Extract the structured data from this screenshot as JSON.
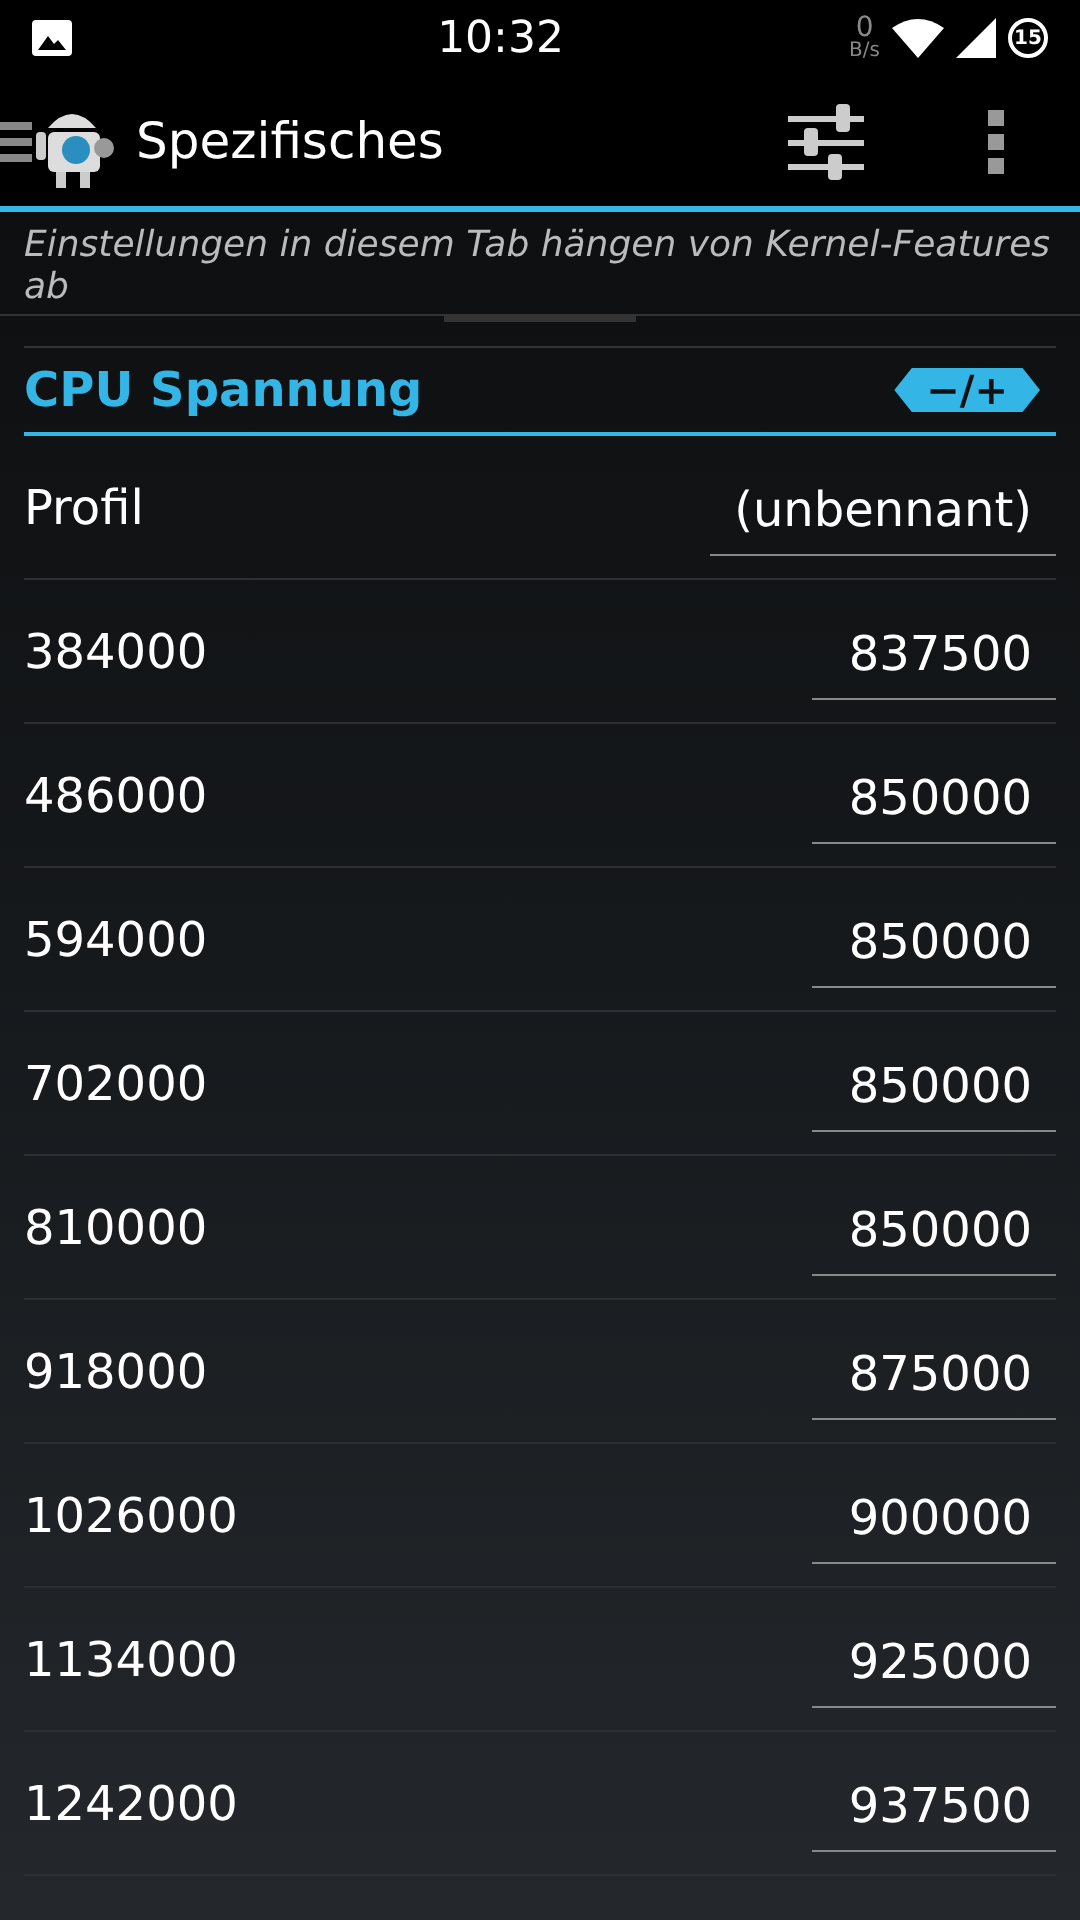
{
  "status_bar": {
    "time": "10:32",
    "net_speed_value": "0",
    "net_speed_unit": "B/s",
    "battery": "15"
  },
  "app_bar": {
    "title": "Spezifisches"
  },
  "notice": "Einstellungen in diesem Tab hängen von Kernel-Features ab",
  "section": {
    "title": "CPU Spannung",
    "step_button": "−/+"
  },
  "rows": [
    {
      "label": "Profil",
      "value": "(unbennant)"
    },
    {
      "label": "384000",
      "value": "837500"
    },
    {
      "label": "486000",
      "value": "850000"
    },
    {
      "label": "594000",
      "value": "850000"
    },
    {
      "label": "702000",
      "value": "850000"
    },
    {
      "label": "810000",
      "value": "850000"
    },
    {
      "label": "918000",
      "value": "875000"
    },
    {
      "label": "1026000",
      "value": "900000"
    },
    {
      "label": "1134000",
      "value": "925000"
    },
    {
      "label": "1242000",
      "value": "937500"
    }
  ]
}
